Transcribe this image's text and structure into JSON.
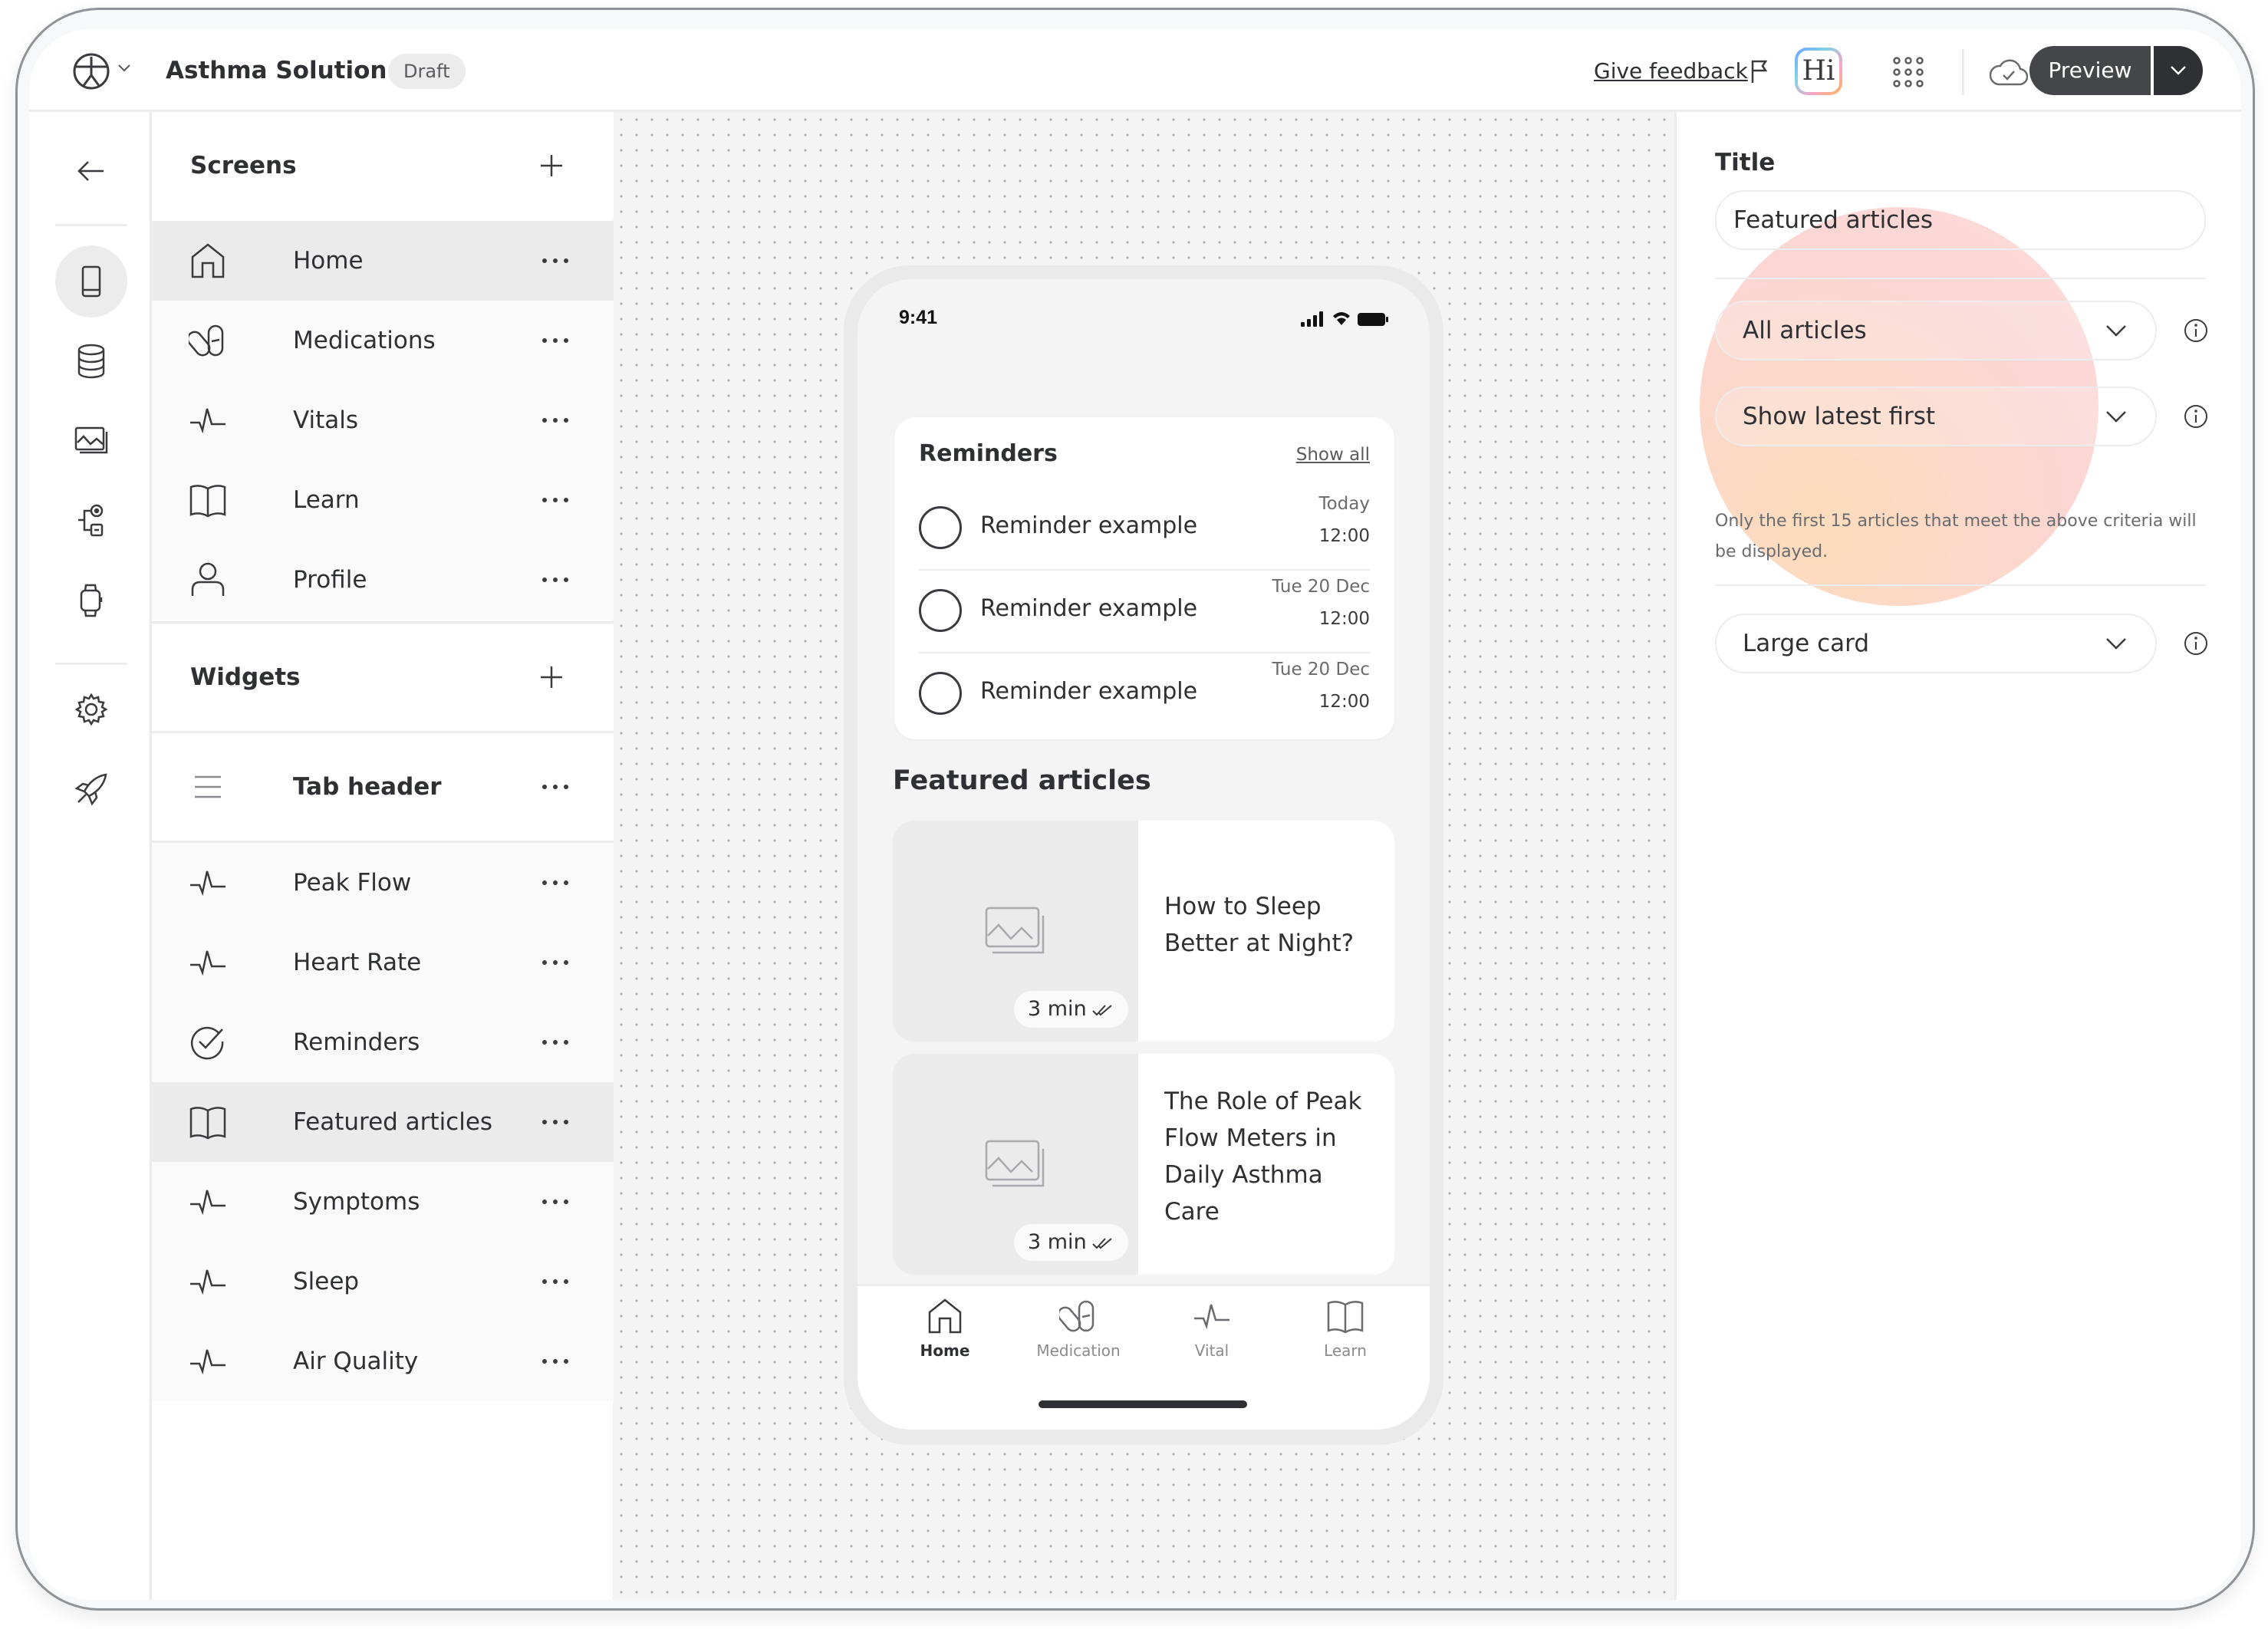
{
  "header": {
    "app_title": "Asthma Solution",
    "status_badge": "Draft",
    "feedback_link": "Give feedback",
    "assistant_badge": "Hi",
    "preview_label": "Preview"
  },
  "rail": {
    "items": [
      {
        "icon": "arrow-left-icon"
      },
      {
        "icon": "phone-screen-icon",
        "active": true
      },
      {
        "icon": "database-icon"
      },
      {
        "icon": "media-gallery-icon"
      },
      {
        "icon": "flow-icon"
      },
      {
        "icon": "smartwatch-icon"
      },
      {
        "icon": "gear-icon"
      },
      {
        "icon": "rocket-icon"
      }
    ]
  },
  "screens": {
    "title": "Screens",
    "items": [
      {
        "label": "Home",
        "icon": "home-icon",
        "selected": true
      },
      {
        "label": "Medications",
        "icon": "pills-icon"
      },
      {
        "label": "Vitals",
        "icon": "pulse-icon"
      },
      {
        "label": "Learn",
        "icon": "book-icon"
      },
      {
        "label": "Profile",
        "icon": "user-icon"
      }
    ]
  },
  "widgets": {
    "title": "Widgets",
    "header_item": {
      "label": "Tab header",
      "icon": "menu-lines-icon"
    },
    "items": [
      {
        "label": "Peak Flow",
        "icon": "pulse-icon"
      },
      {
        "label": "Heart Rate",
        "icon": "pulse-icon"
      },
      {
        "label": "Reminders",
        "icon": "check-circle-icon"
      },
      {
        "label": "Featured articles",
        "icon": "book-icon",
        "selected": true
      },
      {
        "label": "Symptoms",
        "icon": "pulse-icon"
      },
      {
        "label": "Sleep",
        "icon": "pulse-icon"
      },
      {
        "label": "Air Quality",
        "icon": "pulse-icon"
      }
    ]
  },
  "phone": {
    "status_time": "9:41",
    "reminders": {
      "title": "Reminders",
      "show_all": "Show all",
      "items": [
        {
          "label": "Reminder example",
          "date": "Today",
          "time": "12:00"
        },
        {
          "label": "Reminder example",
          "date": "Tue 20 Dec",
          "time": "12:00"
        },
        {
          "label": "Reminder example",
          "date": "Tue 20 Dec",
          "time": "12:00"
        }
      ]
    },
    "featured": {
      "title": "Featured articles",
      "articles": [
        {
          "title": "How to Sleep Better at Night?",
          "read_time": "3 min"
        },
        {
          "title": "The Role of Peak Flow Meters in Daily Asthma Care",
          "read_time": "3 min"
        }
      ]
    },
    "tabs": [
      {
        "label": "Home",
        "icon": "home-icon",
        "active": true
      },
      {
        "label": "Medication",
        "icon": "pills-icon"
      },
      {
        "label": "Vital",
        "icon": "pulse-icon"
      },
      {
        "label": "Learn",
        "icon": "book-icon"
      }
    ]
  },
  "properties": {
    "title_label": "Title",
    "title_value": "Featured articles",
    "filter_select": "All articles",
    "sort_select": "Show latest first",
    "help_text": "Only the first 15 articles that meet the above criteria will be displayed.",
    "layout_select": "Large card"
  },
  "colors": {
    "primary_button": "#45464a",
    "selected_row": "#ebebeb",
    "canvas_bg": "#f4f4f4",
    "highlight_blob": "#fbd3c4"
  }
}
